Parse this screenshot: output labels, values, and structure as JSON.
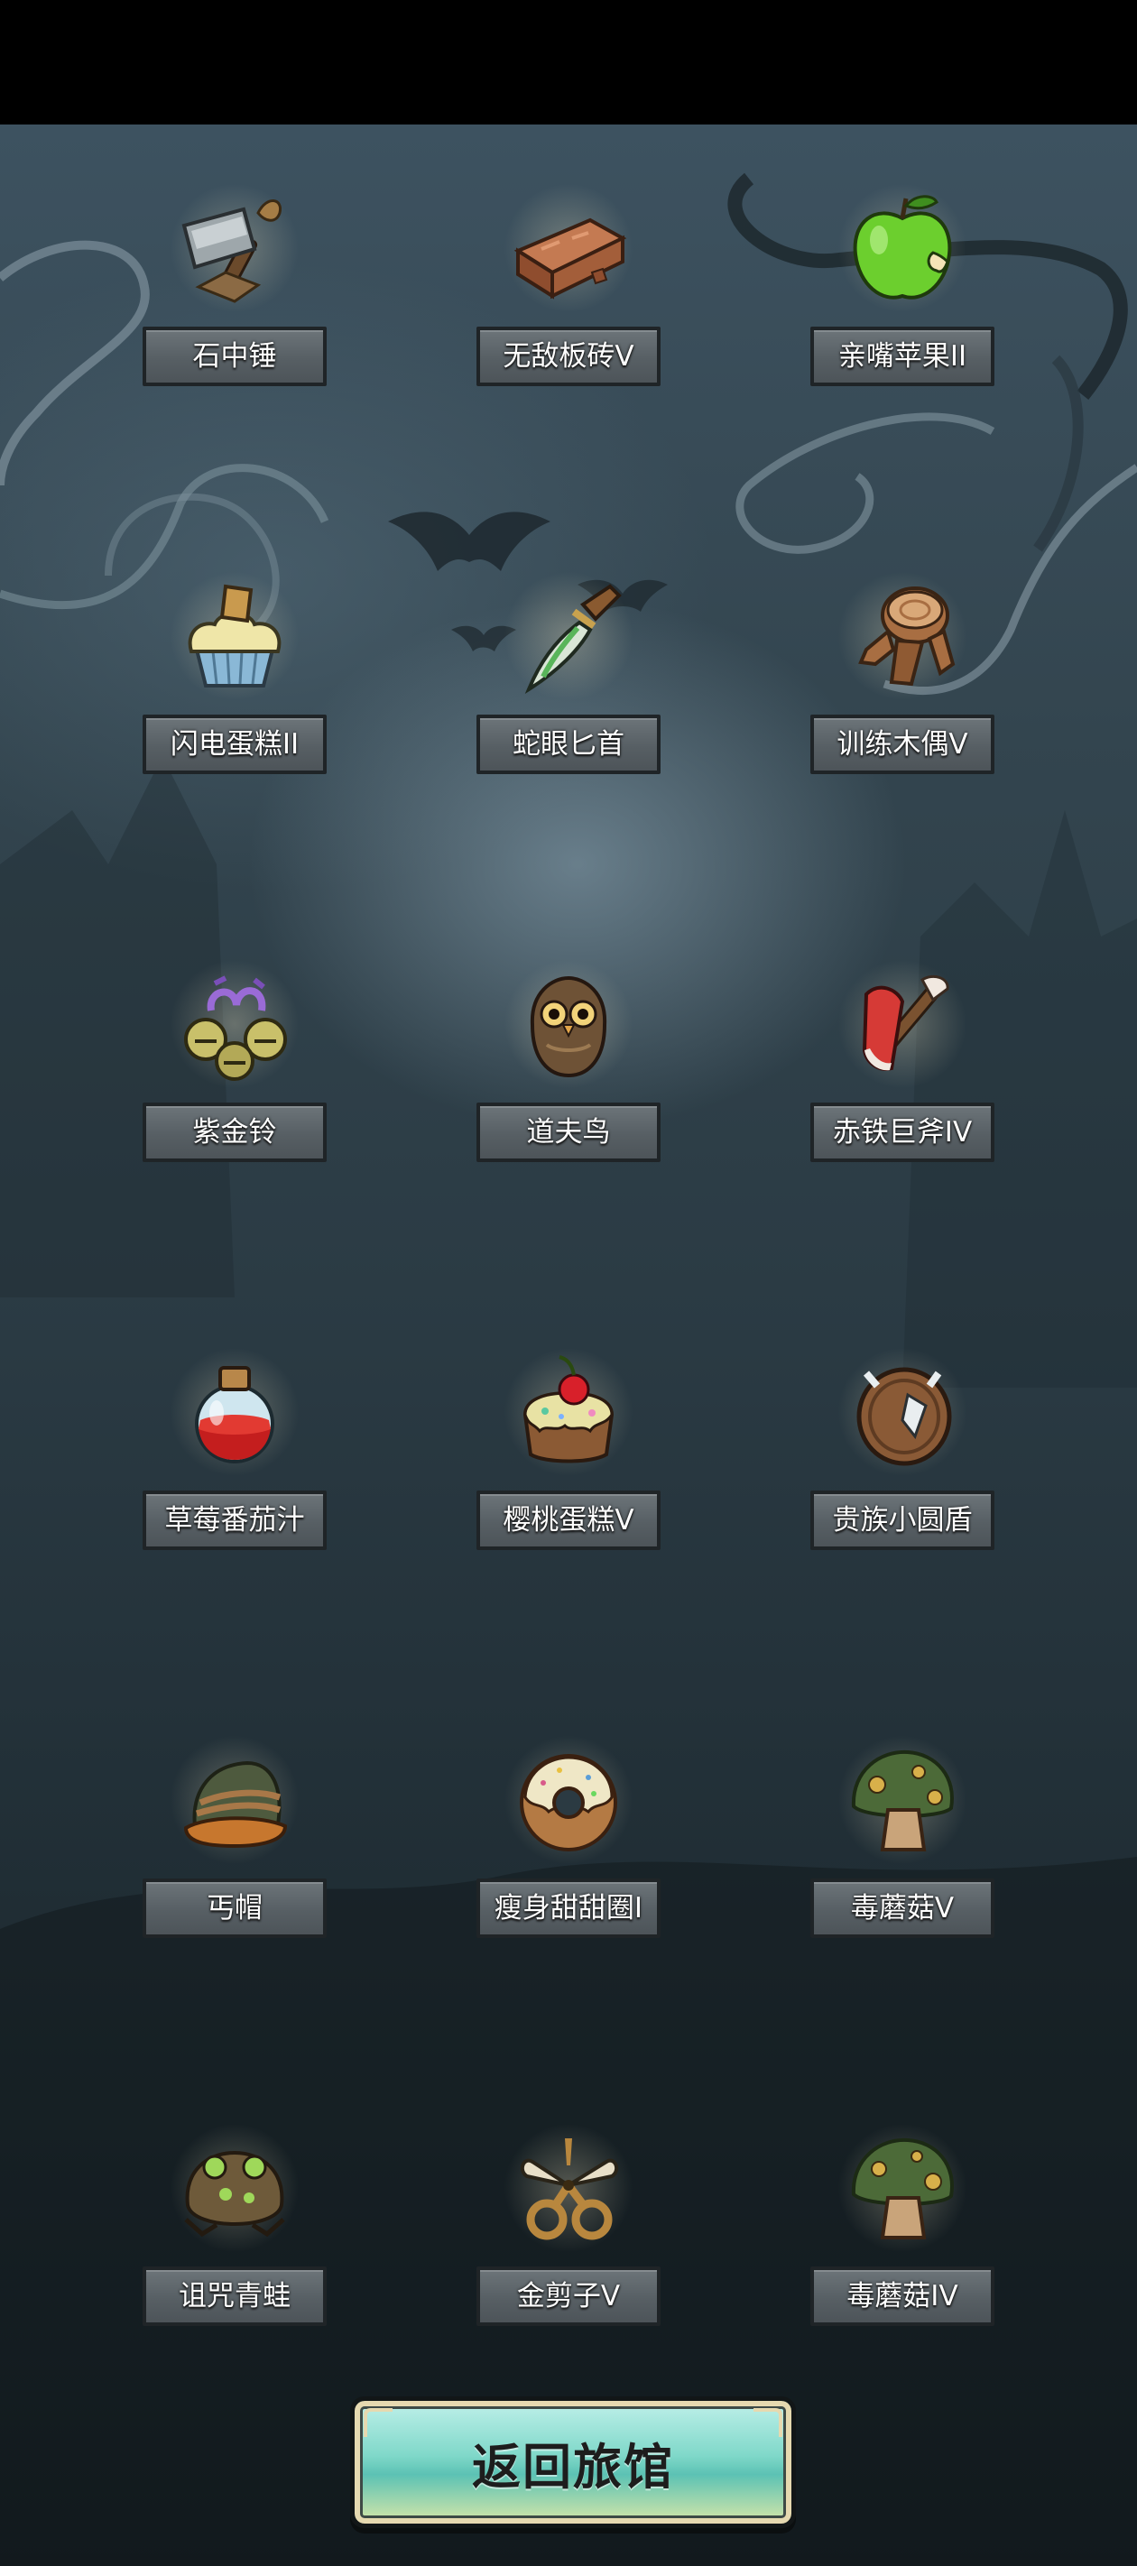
{
  "screen": {
    "items": [
      {
        "name": "石中锤",
        "icon": "hammer-icon"
      },
      {
        "name": "无敌板砖V",
        "icon": "brick-icon"
      },
      {
        "name": "亲嘴苹果II",
        "icon": "apple-icon"
      },
      {
        "name": "闪电蛋糕II",
        "icon": "cupcake-icon"
      },
      {
        "name": "蛇眼匕首",
        "icon": "dagger-icon"
      },
      {
        "name": "训练木偶V",
        "icon": "wooden-dummy-icon"
      },
      {
        "name": "紫金铃",
        "icon": "bells-icon"
      },
      {
        "name": "道夫鸟",
        "icon": "owl-icon"
      },
      {
        "name": "赤铁巨斧IV",
        "icon": "axe-icon"
      },
      {
        "name": "草莓番茄汁",
        "icon": "potion-icon"
      },
      {
        "name": "樱桃蛋糕V",
        "icon": "cherry-cake-icon"
      },
      {
        "name": "贵族小圆盾",
        "icon": "shield-icon"
      },
      {
        "name": "丐帽",
        "icon": "beanie-icon"
      },
      {
        "name": "瘦身甜甜圈I",
        "icon": "donut-icon"
      },
      {
        "name": "毒蘑菇V",
        "icon": "mushroom-icon"
      },
      {
        "name": "诅咒青蛙",
        "icon": "frog-icon"
      },
      {
        "name": "金剪子V",
        "icon": "scissors-icon"
      },
      {
        "name": "毒蘑菇IV",
        "icon": "mushroom-icon"
      }
    ],
    "back_button": {
      "label": "返回旅馆"
    }
  },
  "colors": {
    "label_bg": "#5d6469",
    "label_border": "#1f2427",
    "button_fill": "#7fd8c9"
  }
}
